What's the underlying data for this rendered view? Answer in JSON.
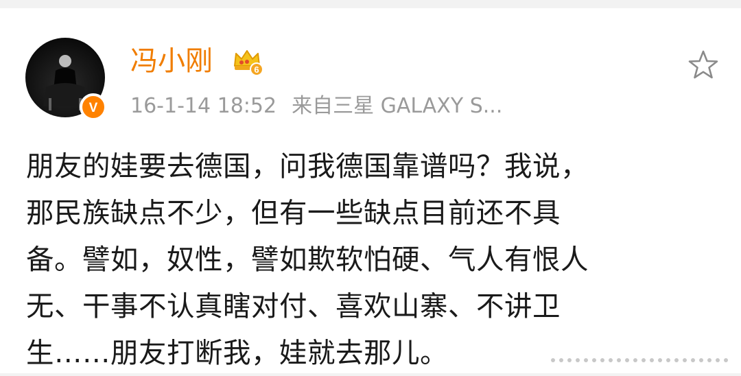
{
  "post": {
    "username": "冯小刚",
    "timestamp": "16-1-14 18:52",
    "source": "来自三星 GALAXY S...",
    "text_lines": [
      "朋友的娃要去德国，问我德国靠谱吗？我说，",
      "那民族缺点不少，但有一些缺点目前还不具",
      "备。譬如，奴性，譬如欺软怕硬、气人有恨人",
      "无、干事不认真瞎对付、喜欢山寨、不讲卫",
      "生……朋友打断我，娃就去那儿。"
    ],
    "vip_level": "6",
    "verified_mark": "V"
  },
  "icons": {
    "avatar": "avatar",
    "verified": "verified-badge-icon",
    "vip": "crown-icon",
    "favorite": "star-icon"
  },
  "colors": {
    "username": "#f07d00",
    "meta": "#9a9a9a",
    "text": "#1a1a1a",
    "badge": "#ff8200"
  }
}
